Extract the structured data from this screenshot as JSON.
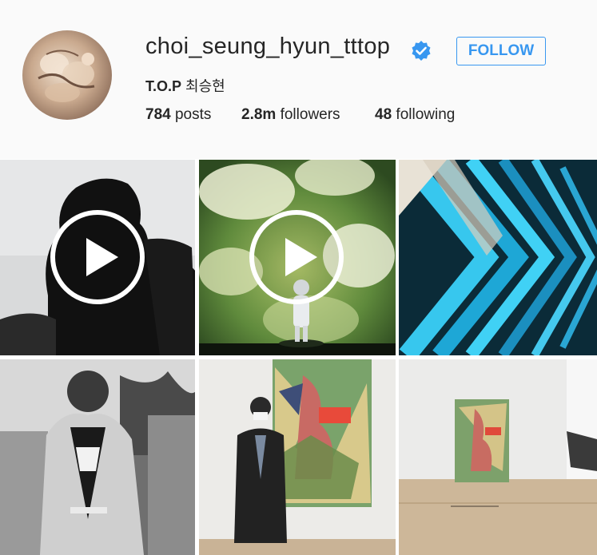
{
  "profile": {
    "username": "choi_seung_hyun_tttop",
    "verified": true,
    "follow_label": "FOLLOW",
    "full_name_bold": "T.O.P",
    "full_name_rest": " 최승현",
    "stats": [
      {
        "count": "784",
        "label": " posts"
      },
      {
        "count": "2.8m",
        "label": " followers"
      },
      {
        "count": "48",
        "label": " following"
      }
    ]
  },
  "colors": {
    "accent": "#3897f0",
    "verified_badge": "#3897f0",
    "header_bg": "#fafafa",
    "text": "#262626"
  },
  "posts": [
    {
      "kind": "video",
      "icon": "play-icon",
      "subject": "silhouette-head"
    },
    {
      "kind": "video",
      "icon": "play-icon",
      "subject": "astronaut-figure-flowers"
    },
    {
      "kind": "photo",
      "subject": "blue-chevron-sculpture"
    },
    {
      "kind": "photo",
      "subject": "bw-portrait"
    },
    {
      "kind": "photo",
      "subject": "man-in-front-of-painting"
    },
    {
      "kind": "photo",
      "subject": "gallery-painting"
    }
  ]
}
